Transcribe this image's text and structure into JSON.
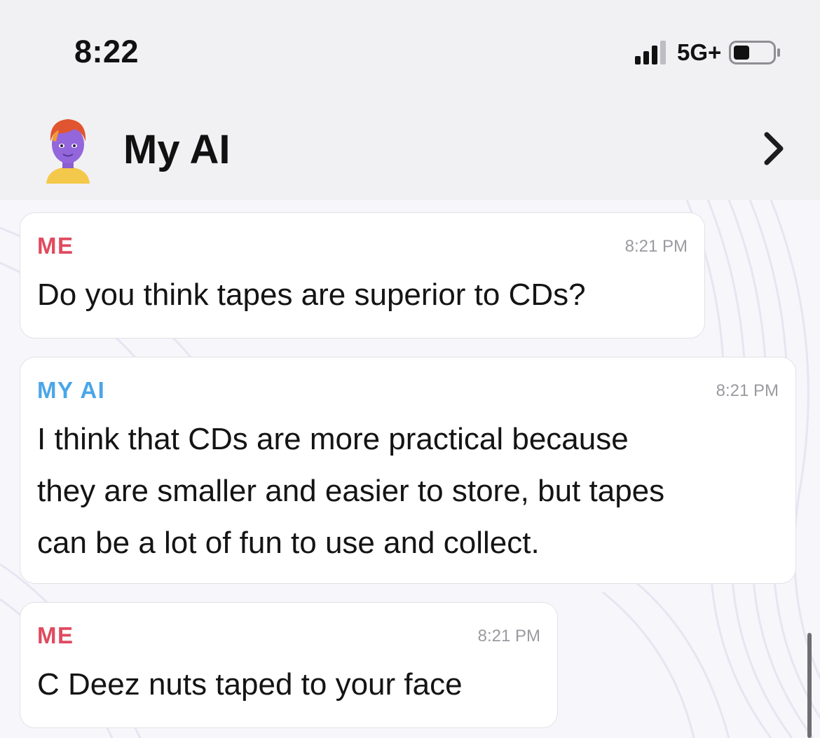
{
  "status_bar": {
    "time": "8:22",
    "network": "5G+",
    "signal_bars": 3,
    "battery_level": 0.35,
    "icons": [
      "signal-icon",
      "battery-icon"
    ]
  },
  "header": {
    "title": "My AI",
    "avatar_icon": "bitmoji-avatar-icon",
    "chevron_icon": "chevron-right-icon"
  },
  "messages": [
    {
      "sender": "ME",
      "time": "8:21 PM",
      "lines": [
        "Do you think tapes are superior to CDs?"
      ]
    },
    {
      "sender": "MY AI",
      "time": "8:21 PM",
      "lines": [
        "I think that CDs are more practical because",
        "they are smaller and easier to store, but tapes",
        "can be a lot of fun to use and collect."
      ]
    },
    {
      "sender": "ME",
      "time": "8:21 PM",
      "lines": [
        "C Deez nuts taped to your face"
      ]
    }
  ],
  "colors": {
    "me_label": "#e04a5f",
    "ai_label": "#4aa6e8",
    "header_bg": "#f1f1f3",
    "bubble_bg": "#ffffff"
  }
}
